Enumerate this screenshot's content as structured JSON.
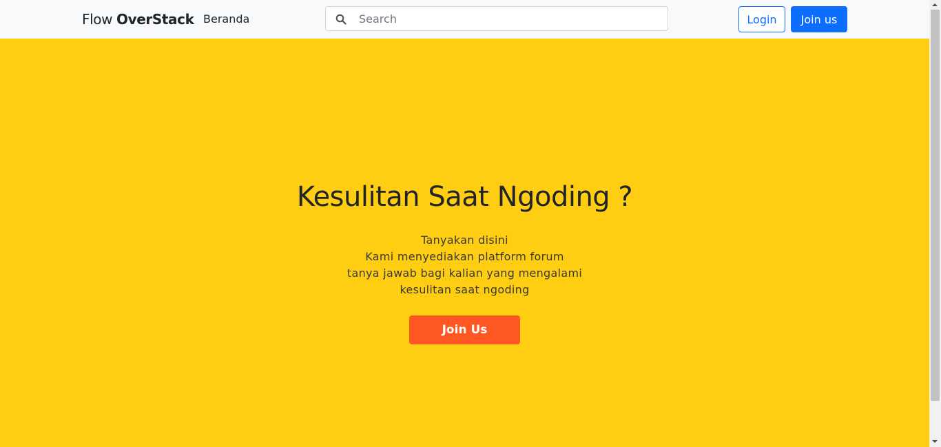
{
  "navbar": {
    "brand_light": "Flow ",
    "brand_bold": "OverStack",
    "nav_link": "Beranda",
    "search_placeholder": "Search",
    "search_icon": "search-icon",
    "login_label": "Login",
    "join_label": "Join us"
  },
  "hero": {
    "title": "Kesulitan Saat Ngoding ?",
    "lines": [
      "Tanyakan disini",
      "Kami menyediakan platform forum",
      "tanya jawab bagi kalian yang mengalami",
      "kesulitan saat ngoding"
    ],
    "cta_label": "Join Us"
  },
  "colors": {
    "hero_background": "#ffcd11",
    "cta": "#ff5722",
    "primary": "#0d6efd",
    "navbar_background": "#f8f9fa"
  }
}
